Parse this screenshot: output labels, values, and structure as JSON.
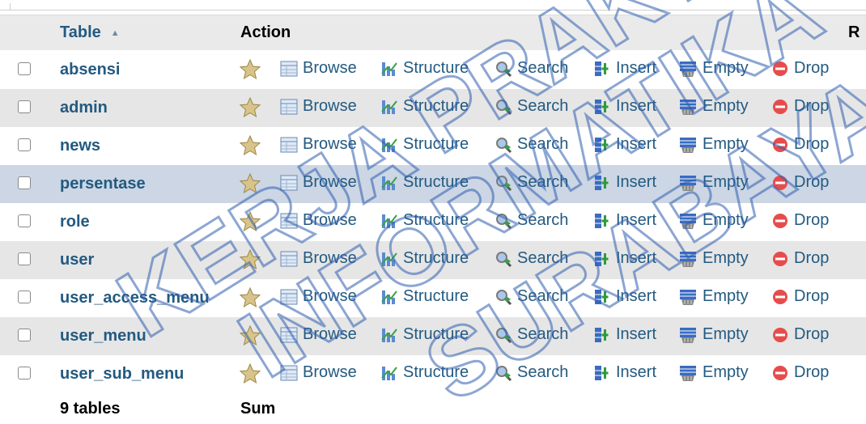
{
  "header": {
    "table_label": "Table",
    "sort_indicator": "▲",
    "action_label": "Action",
    "rows_label": "R"
  },
  "actions": {
    "browse": "Browse",
    "structure": "Structure",
    "search": "Search",
    "insert": "Insert",
    "empty": "Empty",
    "drop": "Drop"
  },
  "rows": [
    {
      "name": "absensi"
    },
    {
      "name": "admin"
    },
    {
      "name": "news"
    },
    {
      "name": "persentase"
    },
    {
      "name": "role"
    },
    {
      "name": "user"
    },
    {
      "name": "user_access_menu"
    },
    {
      "name": "user_menu"
    },
    {
      "name": "user_sub_menu"
    }
  ],
  "footer": {
    "count_label": "9 tables",
    "sum_label": "Sum"
  },
  "watermark": {
    "lines": [
      "KERJA PRAKTEK",
      "INFORMATIKA",
      "SURABAYA"
    ]
  },
  "colors": {
    "link": "#235a81",
    "row_alt": "#e6e6e6",
    "row_highlight": "#ccd6e4",
    "drop": "#e74c4c"
  }
}
